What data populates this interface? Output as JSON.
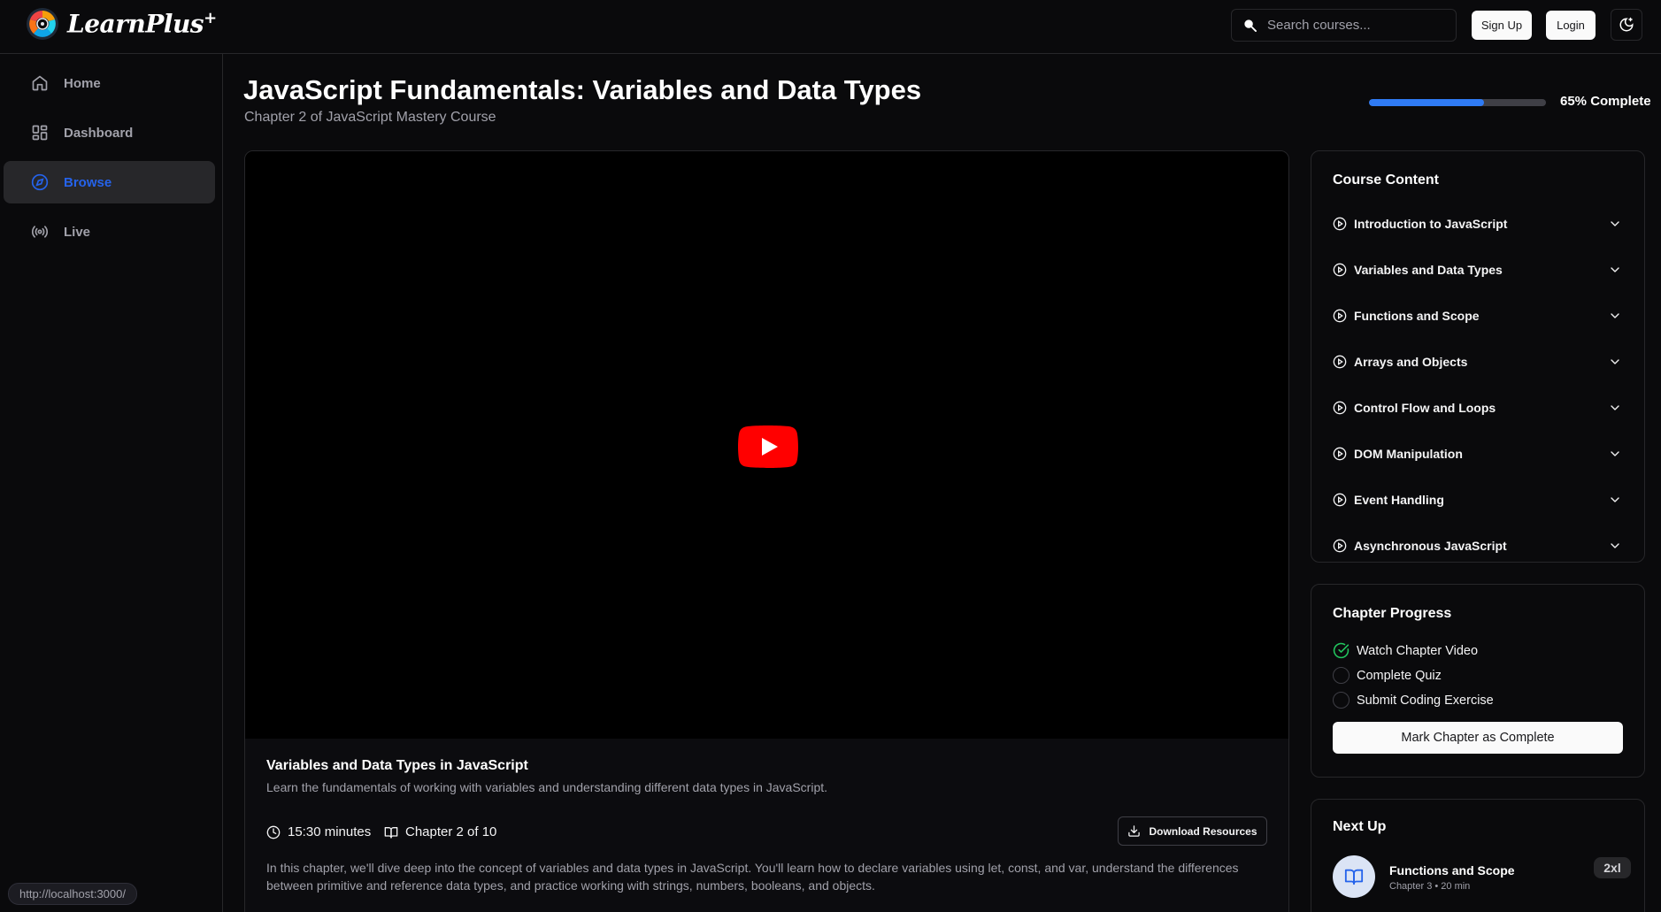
{
  "app": {
    "name": "LearnPlus",
    "name_suffix": "+"
  },
  "header": {
    "search_placeholder": "Search courses...",
    "signup_label": "Sign Up",
    "login_label": "Login",
    "theme_icon": "moon-sun-icon"
  },
  "sidebar": {
    "items": [
      {
        "label": "Home",
        "icon": "home-icon",
        "active": false
      },
      {
        "label": "Dashboard",
        "icon": "dashboard-icon",
        "active": false
      },
      {
        "label": "Browse",
        "icon": "compass-icon",
        "active": true
      },
      {
        "label": "Live",
        "icon": "broadcast-icon",
        "active": false
      }
    ],
    "status_url": "http://localhost:3000/"
  },
  "page": {
    "title": "JavaScript Fundamentals: Variables and Data Types",
    "subtitle": "Chapter 2 of JavaScript Mastery Course",
    "progress_fraction": 0.65,
    "progress_label": "65% Complete"
  },
  "video": {
    "title": "Variables and Data Types in JavaScript",
    "description": "Learn the fundamentals of working with variables and understanding different data types in JavaScript.",
    "duration": "15:30 minutes",
    "chapter": "Chapter 2 of 10",
    "download_label": "Download Resources",
    "long_description": "In this chapter, we'll dive deep into the concept of variables and data types in JavaScript. You'll learn how to declare variables using let, const, and var, understand the differences between primitive and reference data types, and practice working with strings, numbers, booleans, and objects.",
    "play_icon": "youtube-play-icon"
  },
  "course_content": {
    "title": "Course Content",
    "chapters": [
      "Introduction to JavaScript",
      "Variables and Data Types",
      "Functions and Scope",
      "Arrays and Objects",
      "Control Flow and Loops",
      "DOM Manipulation",
      "Event Handling",
      "Asynchronous JavaScript"
    ]
  },
  "chapter_progress": {
    "title": "Chapter Progress",
    "tasks": [
      {
        "label": "Watch Chapter Video",
        "done": true
      },
      {
        "label": "Complete Quiz",
        "done": false
      },
      {
        "label": "Submit Coding Exercise",
        "done": false
      }
    ],
    "mark_complete_label": "Mark Chapter as Complete"
  },
  "next_up": {
    "title": "Next Up",
    "item_title": "Functions and Scope",
    "item_meta": "Chapter 3 • 20 min",
    "speed": "2xl"
  },
  "colors": {
    "accent": "#2563eb",
    "progress": "#2f7bf5",
    "success": "#22c55e",
    "youtube_red": "#ff0000"
  }
}
